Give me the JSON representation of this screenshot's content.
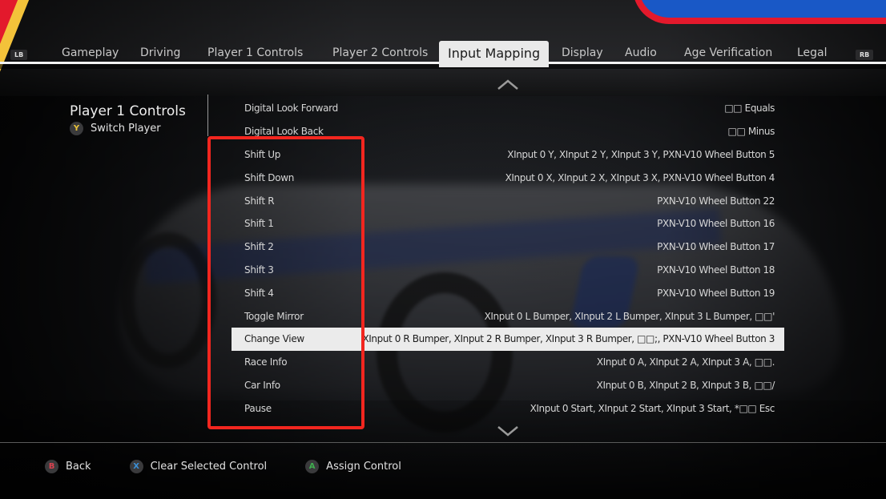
{
  "tabs": {
    "left_shoulder": "LB",
    "right_shoulder": "RB",
    "items": [
      {
        "label": "Gameplay",
        "active": false
      },
      {
        "label": "Driving",
        "active": false
      },
      {
        "label": "Player 1 Controls",
        "active": false
      },
      {
        "label": "Player 2 Controls",
        "active": false
      },
      {
        "label": "Input Mapping",
        "active": true
      },
      {
        "label": "Display",
        "active": false
      },
      {
        "label": "Audio",
        "active": false
      },
      {
        "label": "Age Verification",
        "active": false
      },
      {
        "label": "Legal",
        "active": false
      }
    ]
  },
  "section": {
    "title": "Player 1 Controls",
    "switch_button_glyph": "Y",
    "switch_label": "Switch Player"
  },
  "controls": [
    {
      "name": "Digital Look Forward",
      "binding": "□□ Equals"
    },
    {
      "name": "Digital Look Back",
      "binding": "□□ Minus"
    },
    {
      "name": "Shift Up",
      "binding": "XInput 0 Y, XInput 2 Y, XInput 3 Y, PXN-V10 Wheel Button 5"
    },
    {
      "name": "Shift Down",
      "binding": "XInput 0 X, XInput 2 X, XInput 3 X, PXN-V10 Wheel Button 4"
    },
    {
      "name": "Shift R",
      "binding": "PXN-V10 Wheel Button 22"
    },
    {
      "name": "Shift 1",
      "binding": "PXN-V10 Wheel Button 16"
    },
    {
      "name": "Shift 2",
      "binding": "PXN-V10 Wheel Button 17"
    },
    {
      "name": "Shift 3",
      "binding": "PXN-V10 Wheel Button 18"
    },
    {
      "name": "Shift 4",
      "binding": "PXN-V10 Wheel Button 19"
    },
    {
      "name": "Toggle Mirror",
      "binding": "XInput 0 L Bumper, XInput 2 L Bumper, XInput 3 L Bumper, □□'"
    },
    {
      "name": "Change View",
      "binding": "XInput 0 R Bumper, XInput 2 R Bumper, XInput 3 R Bumper, □□;, PXN-V10 Wheel Button 3",
      "selected": true
    },
    {
      "name": "Race Info",
      "binding": "XInput 0 A, XInput 2 A, XInput 3 A, □□."
    },
    {
      "name": "Car Info",
      "binding": "XInput 0 B, XInput 2 B, XInput 3 B, □□/"
    },
    {
      "name": "Pause",
      "binding": "XInput 0 Start, XInput 2 Start, XInput 3 Start, *□□ Esc"
    }
  ],
  "footer": [
    {
      "glyph": "B",
      "label": "Back",
      "color": "#d9424f"
    },
    {
      "glyph": "X",
      "label": "Clear Selected Control",
      "color": "#3b8fd6"
    },
    {
      "glyph": "A",
      "label": "Assign Control",
      "color": "#3fae4f"
    }
  ],
  "colors": {
    "yellow_button": "#e8c23a",
    "annotation_red": "#f2261f",
    "selected_row_bg": "#ebebeb"
  }
}
